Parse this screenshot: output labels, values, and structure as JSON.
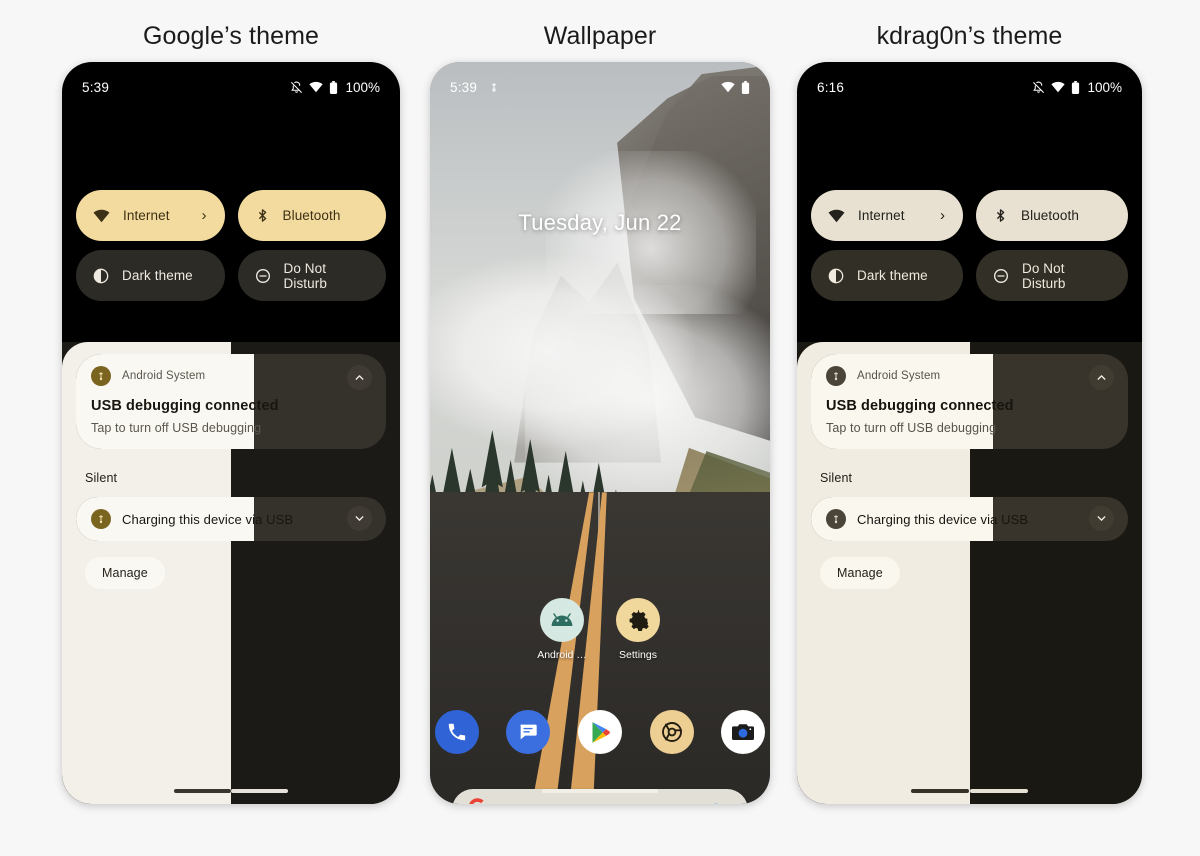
{
  "page": {
    "background": "#f7f7f7"
  },
  "columns": [
    {
      "title": "Google’s theme"
    },
    {
      "title": "Wallpaper"
    },
    {
      "title": "kdrag0n’s theme"
    }
  ],
  "theme_google": {
    "name": "Google’s theme",
    "colors": {
      "accent": "#f3db9f",
      "accent_on": "#3c3016",
      "tile_inactive": "#2d2b26",
      "surface_light": "#f3f0e9",
      "surface_light_alt": "#faf8f2",
      "surface_dark": "#1c1a17",
      "card_dark": "#35322c",
      "avatar_badge": "#7b6420",
      "text_dark": "#1d1b16",
      "text_light": "#ffffff"
    },
    "statusbar": {
      "clock": "5:39",
      "battery_percent": "100%",
      "icons": [
        "notification-muted-icon",
        "wifi-icon",
        "battery-icon"
      ]
    },
    "quick_settings": [
      {
        "label": "Internet",
        "icon": "wifi-icon",
        "active": true,
        "chevron": "›"
      },
      {
        "label": "Bluetooth",
        "icon": "bluetooth-icon",
        "active": true,
        "chevron": ""
      },
      {
        "label": "Dark theme",
        "icon": "contrast-icon",
        "active": false,
        "chevron": ""
      },
      {
        "label": "Do Not Disturb",
        "icon": "minus-circle-icon",
        "active": false,
        "chevron": ""
      }
    ],
    "notifications": {
      "primary": {
        "app": "Android System",
        "title": "USB debugging connected",
        "body": "Tap to turn off USB debugging",
        "avatar_icon": "usb-icon",
        "expand_icon": "chevron-up-icon"
      },
      "section_label": "Silent",
      "silent": {
        "label": "Charging this device via USB",
        "avatar_icon": "usb-icon",
        "expand_icon": "chevron-down-icon"
      },
      "manage_label": "Manage"
    }
  },
  "theme_kdrag0n": {
    "name": "kdrag0n’s theme",
    "colors": {
      "accent": "#e8e1d1",
      "accent_on": "#23211c",
      "tile_inactive": "#322f27",
      "surface_light": "#f0ece1",
      "surface_light_alt": "#faf7ef",
      "surface_dark": "#1a1813",
      "card_dark": "#38342b",
      "avatar_badge": "#4a4439",
      "text_dark": "#1c1a15",
      "text_light": "#ffffff"
    },
    "statusbar": {
      "clock": "6:16",
      "battery_percent": "100%",
      "icons": [
        "notification-muted-icon",
        "wifi-icon",
        "battery-icon"
      ]
    },
    "quick_settings": [
      {
        "label": "Internet",
        "icon": "wifi-icon",
        "active": true,
        "chevron": "›"
      },
      {
        "label": "Bluetooth",
        "icon": "bluetooth-icon",
        "active": true,
        "chevron": ""
      },
      {
        "label": "Dark theme",
        "icon": "contrast-icon",
        "active": false,
        "chevron": ""
      },
      {
        "label": "Do Not Disturb",
        "icon": "minus-circle-icon",
        "active": false,
        "chevron": ""
      }
    ],
    "notifications": {
      "primary": {
        "app": "Android System",
        "title": "USB debugging connected",
        "body": "Tap to turn off USB debugging",
        "avatar_icon": "usb-icon",
        "expand_icon": "chevron-up-icon"
      },
      "section_label": "Silent",
      "silent": {
        "label": "Charging this device via USB",
        "avatar_icon": "usb-icon",
        "expand_icon": "chevron-down-icon"
      },
      "manage_label": "Manage"
    }
  },
  "wallpaper_phone": {
    "name": "Wallpaper",
    "statusbar": {
      "clock": "5:39",
      "icons": [
        "usb-icon",
        "wifi-icon",
        "battery-icon"
      ]
    },
    "date": "Tuesday, Jun 22",
    "home_apps": [
      {
        "label": "Android …",
        "icon": "android-icon",
        "bg": "#d6e8e2"
      },
      {
        "label": "Settings",
        "icon": "gear-icon",
        "bg": "#f0d79b"
      }
    ],
    "dock_apps": [
      {
        "label": "Phone",
        "icon": "phone-icon",
        "bg": "#3063d6"
      },
      {
        "label": "Messages",
        "icon": "messages-icon",
        "bg": "#3b6fe0"
      },
      {
        "label": "Play Store",
        "icon": "play-store-icon",
        "bg": "#ffffff"
      },
      {
        "label": "Chrome",
        "icon": "chrome-icon",
        "bg": "#edcf94"
      },
      {
        "label": "Camera",
        "icon": "camera-icon",
        "bg": "#ffffff"
      }
    ],
    "search": {
      "logo": "google-g-icon",
      "assistant": "assistant-mic-icon",
      "placeholder": ""
    },
    "scene": {
      "description": "Foggy mountain road with pine trees and double yellow center line"
    }
  }
}
